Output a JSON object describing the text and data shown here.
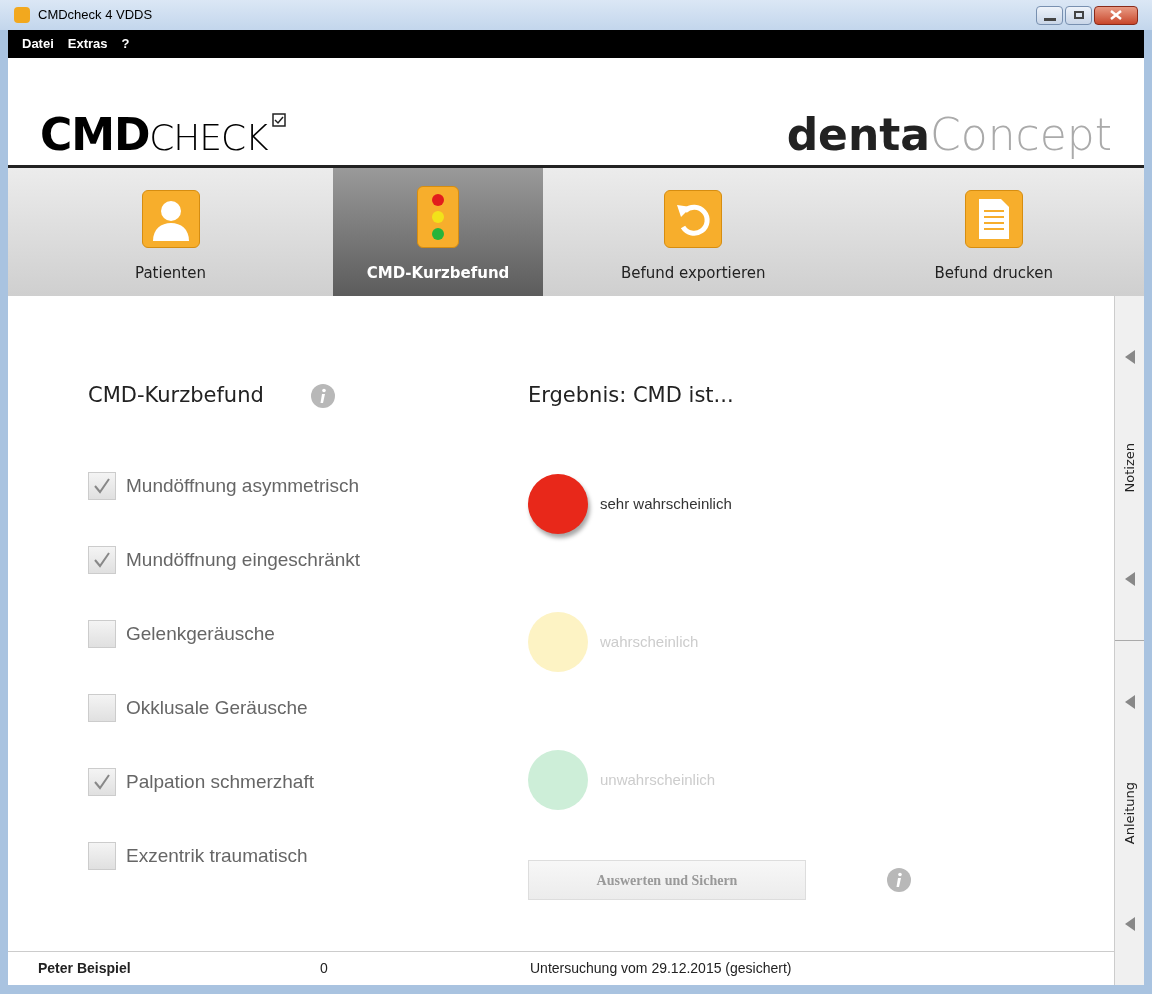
{
  "window": {
    "title": "CMDcheck 4 VDDS"
  },
  "menu": [
    "Datei",
    "Extras",
    "?"
  ],
  "logo": {
    "bold": "CMD",
    "light": "CHECK"
  },
  "brand": {
    "bold": "denta",
    "light": "Concept"
  },
  "tabs": [
    {
      "label": "Patienten",
      "selected": false
    },
    {
      "label": "CMD-Kurzbefund",
      "selected": true
    },
    {
      "label": "Befund exportieren",
      "selected": false
    },
    {
      "label": "Befund drucken",
      "selected": false
    }
  ],
  "findings": {
    "title": "CMD-Kurzbefund",
    "items": [
      {
        "label": "Mundöffnung asymmetrisch",
        "checked": true
      },
      {
        "label": "Mundöffnung eingeschränkt",
        "checked": true
      },
      {
        "label": "Gelenkgeräusche",
        "checked": false
      },
      {
        "label": "Okklusale Geräusche",
        "checked": false
      },
      {
        "label": "Palpation schmerzhaft",
        "checked": true
      },
      {
        "label": "Exzentrik traumatisch",
        "checked": false
      }
    ]
  },
  "result": {
    "title": "Ergebnis: CMD ist...",
    "levels": [
      {
        "label": "sehr wahrscheinlich",
        "color": "#e8281a",
        "active": true
      },
      {
        "label": "wahrscheinlich",
        "color": "#fdf3c4",
        "active": false
      },
      {
        "label": "unwahrscheinlich",
        "color": "#cdeed8",
        "active": false
      }
    ],
    "button": {
      "label": "Auswerten und Sichern",
      "disabled": true
    }
  },
  "side_panels": [
    {
      "label": "Notizen"
    },
    {
      "label": "Anleitung"
    }
  ],
  "status_bar": {
    "patient": "Peter Beispiel",
    "count": "0",
    "exam": "Untersuchung vom 29.12.2015 (gesichert)"
  }
}
